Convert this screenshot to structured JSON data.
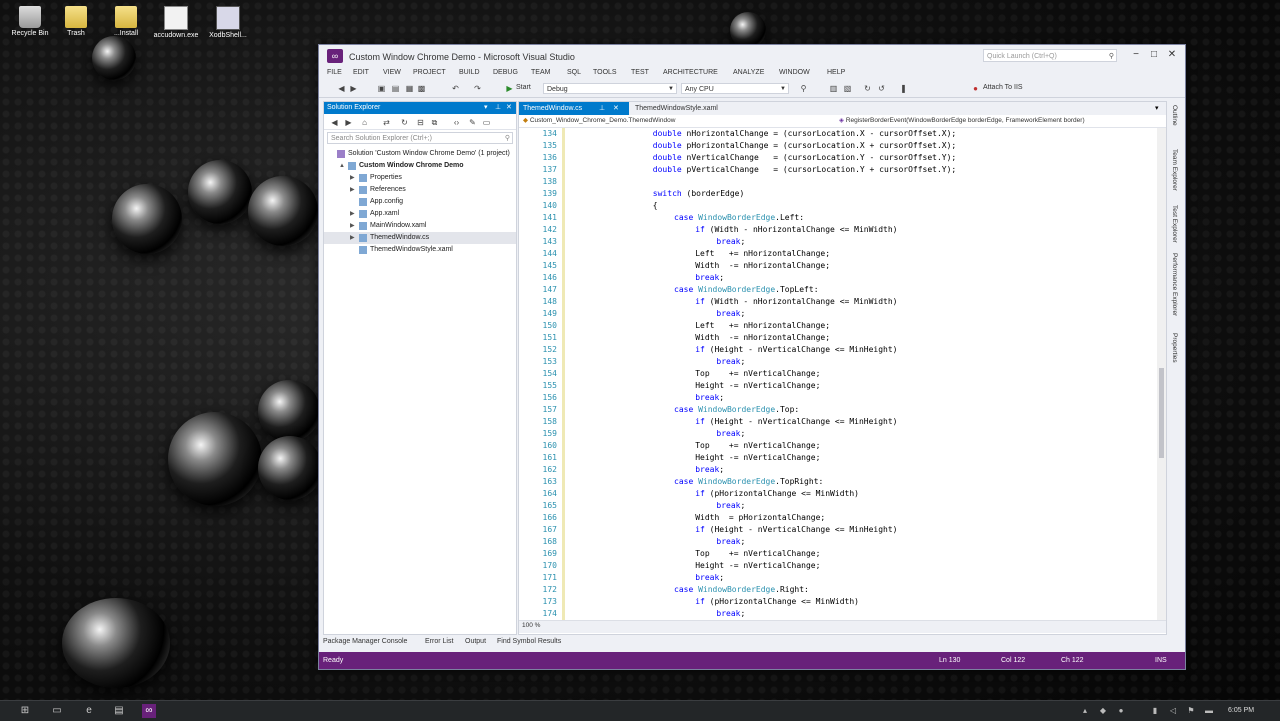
{
  "desktop": {
    "icons": [
      {
        "label": "Recycle Bin",
        "glyph": "recycle-bin-icon"
      },
      {
        "label": "Trash",
        "glyph": "folder-icon"
      },
      {
        "label": "...Install",
        "glyph": "folder-icon"
      },
      {
        "label": "accudown.exe",
        "glyph": "file-icon"
      },
      {
        "label": "XodbShell...",
        "glyph": "app-icon"
      }
    ]
  },
  "window": {
    "title": "Custom Window Chrome Demo - Microsoft Visual Studio",
    "quick_launch_placeholder": "Quick Launch (Ctrl+Q)",
    "menu": [
      "FILE",
      "EDIT",
      "VIEW",
      "PROJECT",
      "BUILD",
      "DEBUG",
      "TEAM",
      "SQL",
      "TOOLS",
      "TEST",
      "ARCHITECTURE",
      "ANALYZE",
      "WINDOW",
      "HELP"
    ],
    "accent": "#68217a",
    "tab_accent": "#007acc"
  },
  "toolbar": {
    "start_label": "Start",
    "config": "Debug",
    "platform": "Any CPU",
    "attach_label": "Attach To IIS"
  },
  "solution_explorer": {
    "title": "Solution Explorer",
    "search_placeholder": "Search Solution Explorer (Ctrl+;)",
    "items": [
      {
        "label": "Solution 'Custom Window Chrome Demo' (1 project)",
        "indent": 0,
        "expander": "",
        "bold": false
      },
      {
        "label": "Custom Window Chrome Demo",
        "indent": 1,
        "expander": "▲",
        "bold": true
      },
      {
        "label": "Properties",
        "indent": 2,
        "expander": "▶",
        "bold": false
      },
      {
        "label": "References",
        "indent": 2,
        "expander": "▶",
        "bold": false
      },
      {
        "label": "App.config",
        "indent": 2,
        "expander": "",
        "bold": false
      },
      {
        "label": "App.xaml",
        "indent": 2,
        "expander": "▶",
        "bold": false
      },
      {
        "label": "MainWindow.xaml",
        "indent": 2,
        "expander": "▶",
        "bold": false
      },
      {
        "label": "ThemedWindow.cs",
        "indent": 2,
        "expander": "▶",
        "bold": false,
        "selected": true
      },
      {
        "label": "ThemedWindowStyle.xaml",
        "indent": 2,
        "expander": "",
        "bold": false
      }
    ]
  },
  "editor": {
    "tabs": [
      {
        "label": "ThemedWindow.cs",
        "active": true
      },
      {
        "label": "ThemedWindowStyle.xaml",
        "active": false
      }
    ],
    "nav_left": "Custom_Window_Chrome_Demo.ThemedWindow",
    "nav_right": "RegisterBorderEvent(WindowBorderEdge borderEdge, FrameworkElement border)",
    "zoom": "100 %",
    "lines": [
      {
        "n": "134",
        "indent": 16,
        "parts": [
          {
            "t": "double",
            "c": "kw"
          },
          {
            "t": " nHorizontalChange = (cursorLocation.X - cursorOffset.X);",
            "c": ""
          }
        ]
      },
      {
        "n": "135",
        "indent": 16,
        "parts": [
          {
            "t": "double",
            "c": "kw"
          },
          {
            "t": " pHorizontalChange = (cursorLocation.X + cursorOffset.X);",
            "c": ""
          }
        ]
      },
      {
        "n": "136",
        "indent": 16,
        "parts": [
          {
            "t": "double",
            "c": "kw"
          },
          {
            "t": " nVerticalChange   = (cursorLocation.Y - cursorOffset.Y);",
            "c": ""
          }
        ]
      },
      {
        "n": "137",
        "indent": 16,
        "parts": [
          {
            "t": "double",
            "c": "kw"
          },
          {
            "t": " pVerticalChange   = (cursorLocation.Y + cursorOffset.Y);",
            "c": ""
          }
        ]
      },
      {
        "n": "138",
        "indent": 0,
        "parts": []
      },
      {
        "n": "139",
        "indent": 16,
        "parts": [
          {
            "t": "switch",
            "c": "kw"
          },
          {
            "t": " (borderEdge)",
            "c": ""
          }
        ]
      },
      {
        "n": "140",
        "indent": 16,
        "parts": [
          {
            "t": "{",
            "c": ""
          }
        ]
      },
      {
        "n": "141",
        "indent": 20,
        "parts": [
          {
            "t": "case",
            "c": "kw"
          },
          {
            "t": " ",
            "c": ""
          },
          {
            "t": "WindowBorderEdge",
            "c": "ty"
          },
          {
            "t": ".Left:",
            "c": ""
          }
        ]
      },
      {
        "n": "142",
        "indent": 24,
        "parts": [
          {
            "t": "if",
            "c": "kw"
          },
          {
            "t": " (Width - nHorizontalChange <= MinWidth)",
            "c": ""
          }
        ]
      },
      {
        "n": "143",
        "indent": 28,
        "parts": [
          {
            "t": "break",
            "c": "kw"
          },
          {
            "t": ";",
            "c": ""
          }
        ]
      },
      {
        "n": "144",
        "indent": 24,
        "parts": [
          {
            "t": "Left   += nHorizontalChange;",
            "c": ""
          }
        ]
      },
      {
        "n": "145",
        "indent": 24,
        "parts": [
          {
            "t": "Width  -= nHorizontalChange;",
            "c": ""
          }
        ]
      },
      {
        "n": "146",
        "indent": 24,
        "parts": [
          {
            "t": "break",
            "c": "kw"
          },
          {
            "t": ";",
            "c": ""
          }
        ]
      },
      {
        "n": "147",
        "indent": 20,
        "parts": [
          {
            "t": "case",
            "c": "kw"
          },
          {
            "t": " ",
            "c": ""
          },
          {
            "t": "WindowBorderEdge",
            "c": "ty"
          },
          {
            "t": ".TopLeft:",
            "c": ""
          }
        ]
      },
      {
        "n": "148",
        "indent": 24,
        "parts": [
          {
            "t": "if",
            "c": "kw"
          },
          {
            "t": " (Width - nHorizontalChange <= MinWidth)",
            "c": ""
          }
        ]
      },
      {
        "n": "149",
        "indent": 28,
        "parts": [
          {
            "t": "break",
            "c": "kw"
          },
          {
            "t": ";",
            "c": ""
          }
        ]
      },
      {
        "n": "150",
        "indent": 24,
        "parts": [
          {
            "t": "Left   += nHorizontalChange;",
            "c": ""
          }
        ]
      },
      {
        "n": "151",
        "indent": 24,
        "parts": [
          {
            "t": "Width  -= nHorizontalChange;",
            "c": ""
          }
        ]
      },
      {
        "n": "152",
        "indent": 24,
        "parts": [
          {
            "t": "if",
            "c": "kw"
          },
          {
            "t": " (Height - nVerticalChange <= MinHeight)",
            "c": ""
          }
        ]
      },
      {
        "n": "153",
        "indent": 28,
        "parts": [
          {
            "t": "break",
            "c": "kw"
          },
          {
            "t": ";",
            "c": ""
          }
        ]
      },
      {
        "n": "154",
        "indent": 24,
        "parts": [
          {
            "t": "Top    += nVerticalChange;",
            "c": ""
          }
        ]
      },
      {
        "n": "155",
        "indent": 24,
        "parts": [
          {
            "t": "Height -= nVerticalChange;",
            "c": ""
          }
        ]
      },
      {
        "n": "156",
        "indent": 24,
        "parts": [
          {
            "t": "break",
            "c": "kw"
          },
          {
            "t": ";",
            "c": ""
          }
        ]
      },
      {
        "n": "157",
        "indent": 20,
        "parts": [
          {
            "t": "case",
            "c": "kw"
          },
          {
            "t": " ",
            "c": ""
          },
          {
            "t": "WindowBorderEdge",
            "c": "ty"
          },
          {
            "t": ".Top:",
            "c": ""
          }
        ]
      },
      {
        "n": "158",
        "indent": 24,
        "parts": [
          {
            "t": "if",
            "c": "kw"
          },
          {
            "t": " (Height - nVerticalChange <= MinHeight)",
            "c": ""
          }
        ]
      },
      {
        "n": "159",
        "indent": 28,
        "parts": [
          {
            "t": "break",
            "c": "kw"
          },
          {
            "t": ";",
            "c": ""
          }
        ]
      },
      {
        "n": "160",
        "indent": 24,
        "parts": [
          {
            "t": "Top    += nVerticalChange;",
            "c": ""
          }
        ]
      },
      {
        "n": "161",
        "indent": 24,
        "parts": [
          {
            "t": "Height -= nVerticalChange;",
            "c": ""
          }
        ]
      },
      {
        "n": "162",
        "indent": 24,
        "parts": [
          {
            "t": "break",
            "c": "kw"
          },
          {
            "t": ";",
            "c": ""
          }
        ]
      },
      {
        "n": "163",
        "indent": 20,
        "parts": [
          {
            "t": "case",
            "c": "kw"
          },
          {
            "t": " ",
            "c": ""
          },
          {
            "t": "WindowBorderEdge",
            "c": "ty"
          },
          {
            "t": ".TopRight:",
            "c": ""
          }
        ]
      },
      {
        "n": "164",
        "indent": 24,
        "parts": [
          {
            "t": "if",
            "c": "kw"
          },
          {
            "t": " (pHorizontalChange <= MinWidth)",
            "c": ""
          }
        ]
      },
      {
        "n": "165",
        "indent": 28,
        "parts": [
          {
            "t": "break",
            "c": "kw"
          },
          {
            "t": ";",
            "c": ""
          }
        ]
      },
      {
        "n": "166",
        "indent": 24,
        "parts": [
          {
            "t": "Width  = pHorizontalChange;",
            "c": ""
          }
        ]
      },
      {
        "n": "167",
        "indent": 24,
        "parts": [
          {
            "t": "if",
            "c": "kw"
          },
          {
            "t": " (Height - nVerticalChange <= MinHeight)",
            "c": ""
          }
        ]
      },
      {
        "n": "168",
        "indent": 28,
        "parts": [
          {
            "t": "break",
            "c": "kw"
          },
          {
            "t": ";",
            "c": ""
          }
        ]
      },
      {
        "n": "169",
        "indent": 24,
        "parts": [
          {
            "t": "Top    += nVerticalChange;",
            "c": ""
          }
        ]
      },
      {
        "n": "170",
        "indent": 24,
        "parts": [
          {
            "t": "Height -= nVerticalChange;",
            "c": ""
          }
        ]
      },
      {
        "n": "171",
        "indent": 24,
        "parts": [
          {
            "t": "break",
            "c": "kw"
          },
          {
            "t": ";",
            "c": ""
          }
        ]
      },
      {
        "n": "172",
        "indent": 20,
        "parts": [
          {
            "t": "case",
            "c": "kw"
          },
          {
            "t": " ",
            "c": ""
          },
          {
            "t": "WindowBorderEdge",
            "c": "ty"
          },
          {
            "t": ".Right:",
            "c": ""
          }
        ]
      },
      {
        "n": "173",
        "indent": 24,
        "parts": [
          {
            "t": "if",
            "c": "kw"
          },
          {
            "t": " (pHorizontalChange <= MinWidth)",
            "c": ""
          }
        ]
      },
      {
        "n": "174",
        "indent": 28,
        "parts": [
          {
            "t": "break",
            "c": "kw"
          },
          {
            "t": ";",
            "c": ""
          }
        ]
      }
    ]
  },
  "side_tabs": [
    "Outline",
    "Team Explorer",
    "Test Explorer",
    "Performance Explorer",
    "Properties"
  ],
  "bottom_tabs": [
    "Package Manager Console",
    "Error List",
    "Output",
    "Find Symbol Results"
  ],
  "status": {
    "ready": "Ready",
    "line": "Ln 130",
    "col": "Col 122",
    "ch": "Ch 122",
    "mode": "INS"
  },
  "taskbar": {
    "time": "6:05 PM"
  }
}
